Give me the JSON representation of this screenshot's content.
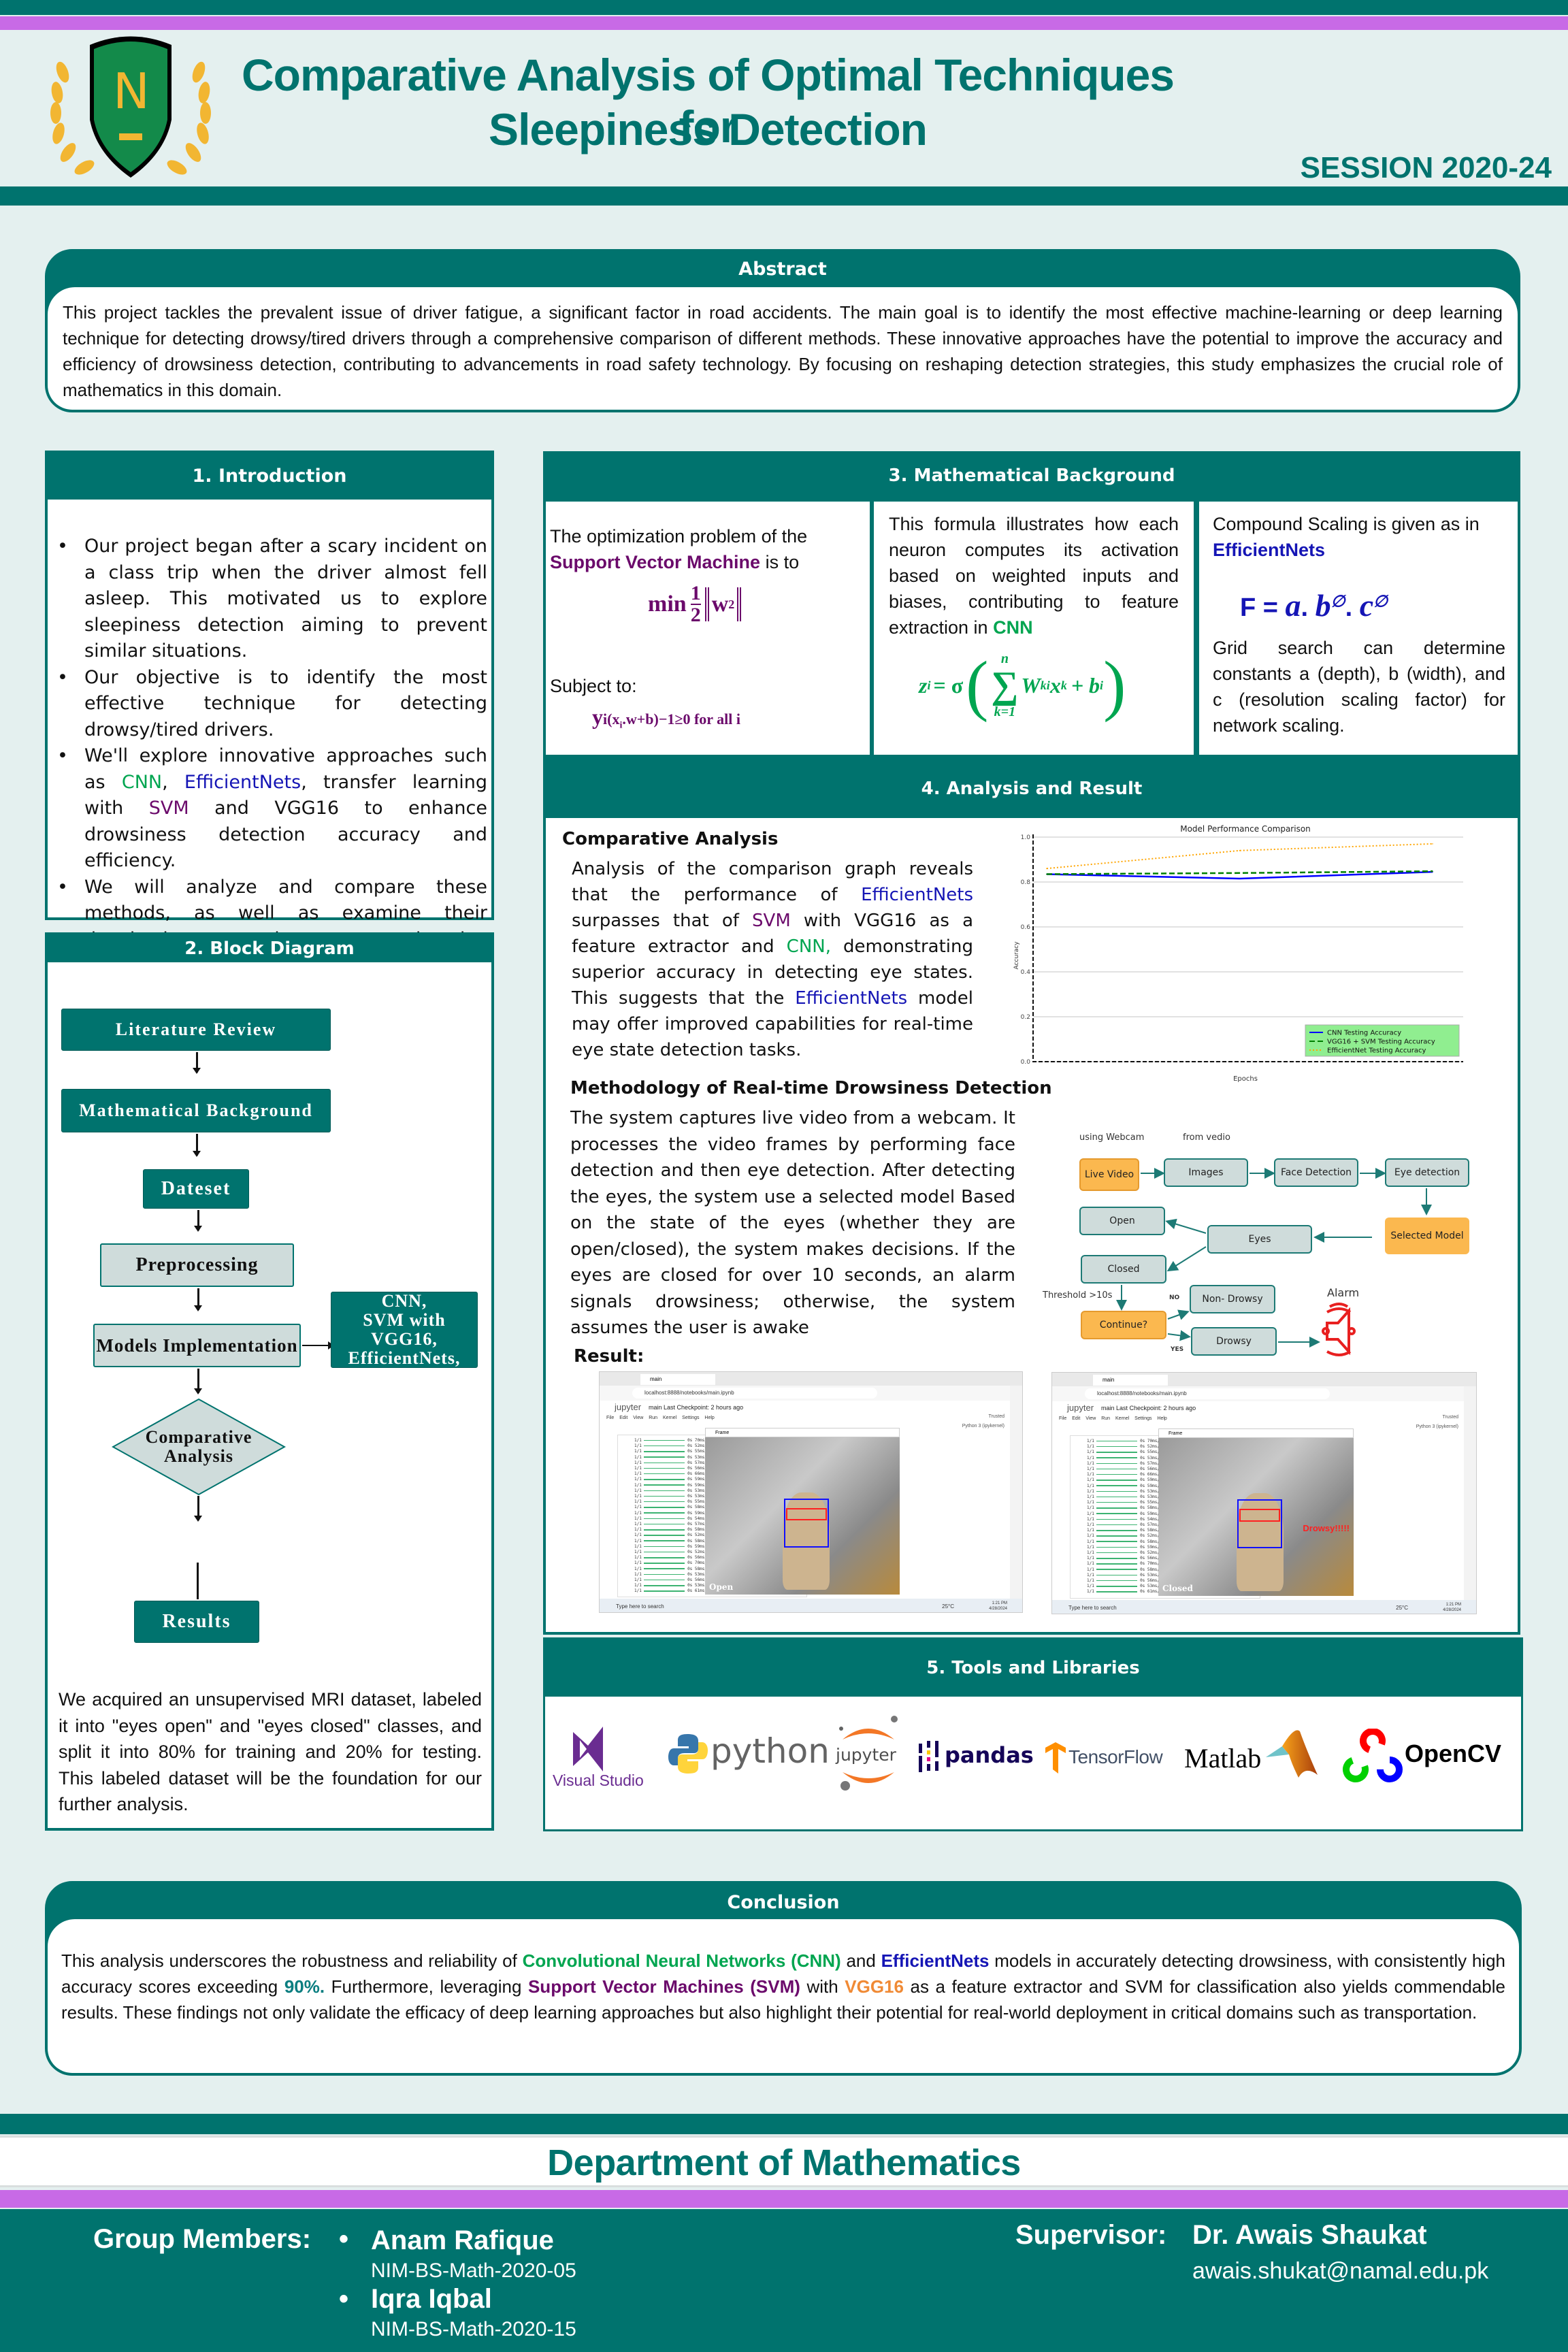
{
  "header": {
    "title_line1": "Comparative Analysis  of Optimal Techniques for",
    "title_line2": "Sleepiness Detection",
    "session": "SESSION 2020-24",
    "logo_letter": "N"
  },
  "abstract": {
    "heading": "Abstract",
    "text": "This project tackles the prevalent issue of driver fatigue, a significant factor in road accidents. The main goal is to identify the most effective machine-learning or deep learning technique for detecting drowsy/tired drivers through a comprehensive comparison of different methods. These innovative approaches have the potential to improve the accuracy and efficiency of drowsiness detection, contributing to advancements in road safety technology. By focusing on reshaping detection strategies, this study emphasizes the crucial role of mathematics in this domain."
  },
  "introduction": {
    "heading": "1. Introduction",
    "bullets": [
      {
        "text": "Our project began after a scary incident on a class trip when the driver almost fell asleep. This motivated us to explore sleepiness detection aiming to prevent similar situations."
      },
      {
        "text": "Our objective is to identify the most effective technique for detecting drowsy/tired drivers."
      },
      {
        "pre": "We'll explore innovative approaches such as ",
        "cnn": "CNN",
        "sep1": ", ",
        "eff": "EfficientNets",
        "mid": ", transfer learning with ",
        "svm": "SVM",
        "post": " and VGG16 to enhance drowsiness detection accuracy and efficiency."
      },
      {
        "text": "We will analyze and compare these methods, as well as examine their drawbacks, to gain a comprehensive understanding of their effectiveness."
      }
    ]
  },
  "block_diagram": {
    "heading": "2. Block Diagram",
    "nodes": {
      "literature_review": "Literature Review",
      "math_background": "Mathematical Background",
      "dataset": "Dateset",
      "preprocessing": "Preprocessing",
      "models_implementation": "Models Implementation",
      "models_list": [
        "CNN,",
        "SVM with",
        "VGG16,",
        "EfficientNets,"
      ],
      "comparative_analysis": [
        "Comparative",
        "Analysis"
      ],
      "results": "Results"
    },
    "dataset_text": "We acquired an unsupervised MRI dataset, labeled it into \"eyes open\" and \"eyes closed\" classes, and split it into 80% for training and 20% for testing. This labeled dataset will be the foundation for our further analysis."
  },
  "math_background": {
    "heading": "3. Mathematical Background",
    "svm": {
      "intro_pre": "The optimization problem of the ",
      "intro_term": "Support Vector Machine",
      "intro_post": " is  to",
      "formula_min": "min",
      "formula_num": "1",
      "formula_den": "2",
      "formula_norm": "w",
      "formula_exp": "2",
      "subject_to": "Subject to:",
      "constraint_y": "y",
      "constraint_sub": "i(x",
      "constraint_sub2": "i",
      "constraint_rest": ".w+b)−1≥0  for all i"
    },
    "cnn": {
      "text_pre": "This formula illustrates how each neuron computes its activation based on weighted inputs and biases, contributing to feature extraction in ",
      "text_term": "CNN",
      "formula_lhs": "z",
      "formula_lhs_sub": "i",
      "formula_eq": " = σ",
      "sum_top": "n",
      "sum_bottom": "k=1",
      "sum_sym": "∑",
      "term_w": "W",
      "term_w_sub": "ki",
      "term_x": "x",
      "term_x_sub": "k",
      "term_plus": " + b",
      "term_b_sub": "i"
    },
    "efficientnet": {
      "text_pre": "Compound Scaling  is given as in ",
      "text_term": "EfficientNets",
      "formula_F": "F = ",
      "formula_a": "a",
      "formula_dot1": ". ",
      "formula_b": "b",
      "formula_phi": "∅",
      "formula_dot2": ". ",
      "formula_c": "c",
      "text_after": "Grid search can determine constants a (depth), b (width), and c (resolution scaling factor) for network scaling."
    }
  },
  "analysis": {
    "heading": "4. Analysis and Result",
    "comparative_title": "Comparative Analysis",
    "comparative_text": {
      "p1": "Analysis of the comparison graph reveals that the performance of ",
      "eff1": "EfficientNets",
      "p2": " surpasses that of ",
      "svm": "SVM",
      "p3": " with VGG16 as a feature extractor and ",
      "cnn": "CNN,",
      "p4": " demonstrating superior accuracy in detecting eye states. This suggests that the ",
      "eff2": "EfficientNets",
      "p5": " model may offer improved capabilities for real-time eye state detection tasks."
    },
    "methodology_title": "Methodology of Real-time Drowsiness Detection",
    "methodology_text": "The system captures live video from a webcam. It processes the video frames by performing face detection and then eye detection. After detecting the eyes, the system use a selected model Based on the state of the eyes (whether they are open/closed), the system makes decisions. If the eyes are closed for over 10 seconds, an alarm signals drowsiness; otherwise, the system assumes the user is awake",
    "result_label": "Result:",
    "flowchart": {
      "label_webcam": "using Webcam",
      "label_video": "from vedio",
      "live_video": "Live Video",
      "images": "Images",
      "face_detection": "Face Detection",
      "eye_detection": "Eye detection",
      "selected_model": "Selected Model",
      "eyes": "Eyes",
      "open": "Open",
      "closed": "Closed",
      "threshold": "Threshold >10s",
      "continue": "Continue?",
      "no": "NO",
      "yes": "YES",
      "non_drowsy": "Non- Drowsy",
      "drowsy": "Drowsy",
      "alarm": "Alarm"
    },
    "screenshots": [
      {
        "url": "localhost:8888/notebooks/main.ipynb",
        "tab": "main",
        "app": "jupyter",
        "notebook": "main",
        "checkpoint": "Last Checkpoint: 2 hours ago",
        "frame_title": "Frame",
        "status": "Open",
        "overlay": "",
        "kernel": "Python 3 (ipykernel)",
        "trusted": "Trusted",
        "search": "Type here to search",
        "temp": "25°C",
        "time": "1:21 PM",
        "date": "4/28/2024",
        "menu": [
          "File",
          "Edit",
          "View",
          "Run",
          "Kernel",
          "Settings",
          "Help"
        ],
        "log_rows": [
          "70ms/step",
          "52ms/step",
          "55ms/step",
          "53ms/step",
          "57ms/step",
          "56ms/step",
          "66ms/step",
          "59ms/step",
          "59ms/step",
          "53ms/step",
          "53ms/step",
          "55ms/step",
          "58ms/step",
          "59ms/step",
          "54ms/step",
          "57ms/step",
          "58ms/step",
          "52ms/step",
          "58ms/step",
          "59ms/step",
          "52ms/step",
          "56ms/step",
          "70ms/step",
          "58ms/step",
          "53ms/step",
          "56ms/step",
          "53ms/step",
          "61ms/step"
        ]
      },
      {
        "url": "localhost:8888/notebooks/main.ipynb",
        "tab": "main",
        "app": "jupyter",
        "notebook": "main",
        "checkpoint": "Last Checkpoint: 2 hours ago",
        "frame_title": "Frame",
        "status": "Closed",
        "overlay": "Drowsy!!!!!",
        "kernel": "Python 3 (ipykernel)",
        "trusted": "Trusted",
        "search": "Type here to search",
        "temp": "25°C",
        "time": "1:21 PM",
        "date": "4/28/2024",
        "menu": [
          "File",
          "Edit",
          "View",
          "Run",
          "Kernel",
          "Settings",
          "Help"
        ],
        "log_rows": [
          "70ms/step",
          "52ms/step",
          "55ms/step",
          "53ms/step",
          "57ms/step",
          "56ms/step",
          "66ms/step",
          "59ms/step",
          "59ms/step",
          "53ms/step",
          "53ms/step",
          "55ms/step",
          "58ms/step",
          "59ms/step",
          "54ms/step",
          "57ms/step",
          "58ms/step",
          "52ms/step",
          "58ms/step",
          "59ms/step",
          "52ms/step",
          "56ms/step",
          "70ms/step",
          "58ms/step",
          "53ms/step",
          "56ms/step",
          "53ms/step",
          "61ms/step"
        ]
      }
    ]
  },
  "chart_data": {
    "type": "line",
    "title": "Model Performance Comparison",
    "xlabel": "Epochs",
    "ylabel": "Accuracy",
    "x": [
      1,
      2,
      3
    ],
    "ylim": [
      0.0,
      1.0
    ],
    "yticks": [
      "0.0",
      "0.2",
      "0.4",
      "0.6",
      "0.8",
      "1.0"
    ],
    "grid": true,
    "legend_position": "bottom-right",
    "legend_bg": "#90ee90",
    "series": [
      {
        "name": "CNN Testing Accuracy",
        "values": [
          0.835,
          0.815,
          0.845
        ],
        "color": "#0000ff",
        "style": "solid"
      },
      {
        "name": "VGG16 + SVM Testing Accuracy",
        "values": [
          0.835,
          0.84,
          0.848
        ],
        "color": "#008000",
        "style": "dashed"
      },
      {
        "name": "EfficientNet Testing Accuracy",
        "values": [
          0.86,
          0.94,
          0.97
        ],
        "color": "#ffa500",
        "style": "dotted"
      }
    ]
  },
  "tools": {
    "heading": "5. Tools and Libraries",
    "items": [
      {
        "name": "Visual Studio",
        "icon": "visual-studio-icon"
      },
      {
        "name": "python",
        "icon": "python-icon"
      },
      {
        "name": "jupyter",
        "icon": "jupyter-icon"
      },
      {
        "name": "pandas",
        "icon": "pandas-icon"
      },
      {
        "name": "TensorFlow",
        "icon": "tensorflow-icon"
      },
      {
        "name": "Matlab",
        "icon": "matlab-icon"
      },
      {
        "name": "OpenCV",
        "icon": "opencv-icon"
      }
    ]
  },
  "conclusion": {
    "heading": "Conclusion",
    "p1": "This analysis underscores the robustness and reliability of ",
    "cnn": "Convolutional Neural Networks (CNN)",
    "p2": " and ",
    "eff": "EfficientNets",
    "p3": " models in accurately detecting drowsiness, with consistently high accuracy scores exceeding ",
    "pct": "90%.",
    "p4": " Furthermore, leveraging ",
    "svm": "Support Vector Machines (SVM)",
    "p5": " with ",
    "vgg": "VGG16",
    "p6": " as a feature extractor and SVM for classification also yields commendable results. These findings not only validate the efficacy of deep learning approaches but also highlight their potential for real-world deployment in critical domains such as transportation."
  },
  "footer": {
    "department": "Department of Mathematics",
    "group_label": "Group Members:",
    "members": [
      {
        "name": "Anam Rafique",
        "id": "NIM-BS-Math-2020-05"
      },
      {
        "name": "Iqra Iqbal",
        "id": "NIM-BS-Math-2020-15"
      }
    ],
    "supervisor_label": "Supervisor:",
    "supervisor_name": "Dr. Awais Shaukat",
    "supervisor_email": "awais.shukat@namal.edu.pk"
  },
  "colors": {
    "teal": "#00736e",
    "purple_band": "#c86ae6",
    "cnn_green": "#00a550",
    "efficientnet_blue": "#1515b5",
    "svm_purple": "#6b0a6b",
    "vgg_orange": "#f08a35",
    "logo_gold": "#f2b632",
    "logo_green": "#138a4a"
  }
}
